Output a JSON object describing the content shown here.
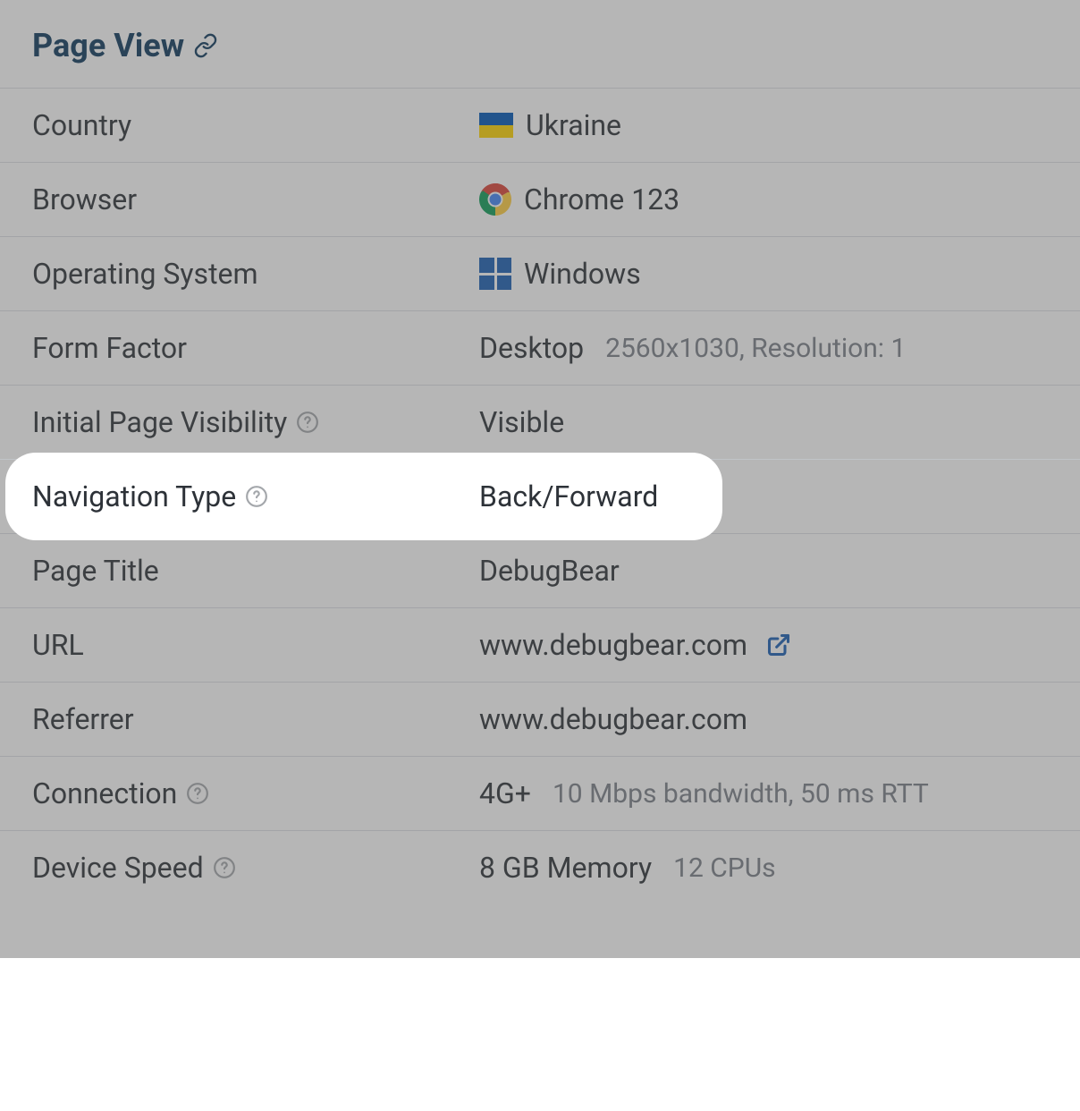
{
  "header": {
    "title": "Page View"
  },
  "rows": {
    "country": {
      "label": "Country",
      "value": "Ukraine"
    },
    "browser": {
      "label": "Browser",
      "value": "Chrome 123"
    },
    "os": {
      "label": "Operating System",
      "value": "Windows"
    },
    "form_factor": {
      "label": "Form Factor",
      "value": "Desktop",
      "secondary": "2560x1030, Resolution: 1"
    },
    "visibility": {
      "label": "Initial Page Visibility",
      "value": "Visible"
    },
    "nav_type": {
      "label": "Navigation Type",
      "value": "Back/Forward"
    },
    "page_title": {
      "label": "Page Title",
      "value": "DebugBear"
    },
    "url": {
      "label": "URL",
      "value": "www.debugbear.com"
    },
    "referrer": {
      "label": "Referrer",
      "value": "www.debugbear.com"
    },
    "connection": {
      "label": "Connection",
      "value": "4G+",
      "secondary": "10 Mbps bandwidth, 50 ms RTT"
    },
    "device_speed": {
      "label": "Device Speed",
      "value": "8 GB Memory",
      "secondary": "12 CPUs"
    }
  }
}
